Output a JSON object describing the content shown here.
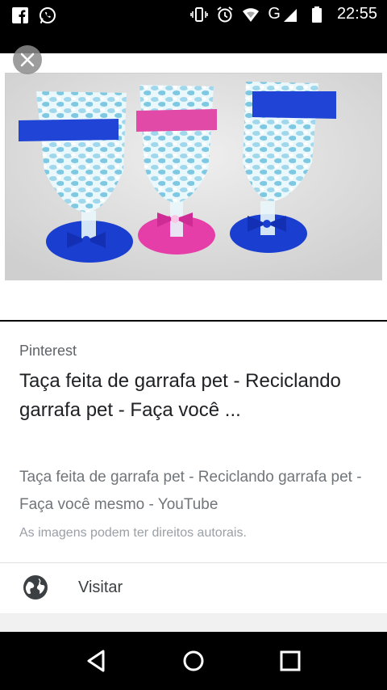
{
  "status_bar": {
    "time": "22:55",
    "network": "G",
    "icons": [
      "facebook-icon",
      "whatsapp-icon",
      "vibrate-icon",
      "alarm-icon",
      "wifi-icon",
      "signal-icon",
      "battery-icon"
    ]
  },
  "result": {
    "source": "Pinterest",
    "title": "Taça feita de garrafa pet - Reciclando garrafa pet - Faça você ...",
    "description": "Taça feita de garrafa pet - Reciclando garrafa pet - Faça você mesmo - YouTube",
    "copyright_notice": "As imagens podem ter direitos autorais."
  },
  "actions": {
    "visit_label": "Visitar",
    "visit_icon": "globe-icon"
  },
  "nav": {
    "icons": [
      "back-icon",
      "home-icon",
      "recents-icon"
    ]
  },
  "colors": {
    "blue_cup": "#1a3fd0",
    "pink_cup": "#e63ea8",
    "cotton_candy": "#bfe6f2"
  }
}
